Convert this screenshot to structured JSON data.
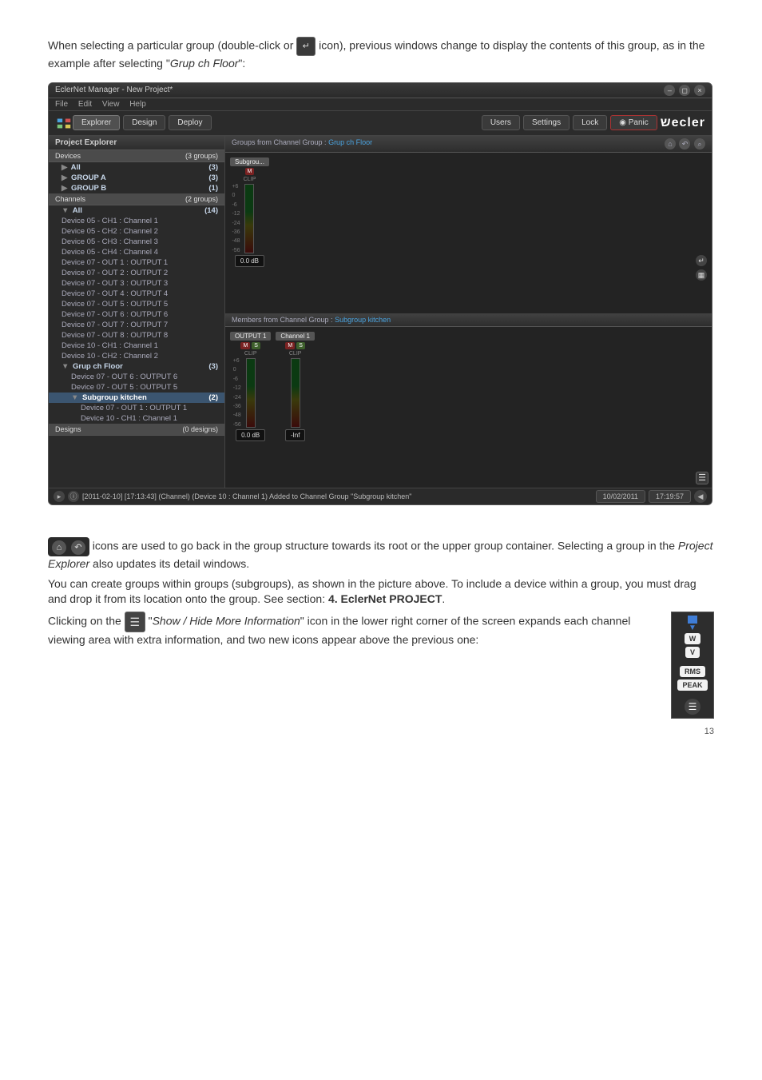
{
  "intro": {
    "p1a": "When selecting a particular group (double-click or ",
    "p1b": " icon), previous windows change to display the contents of this group, as in the example after selecting \"",
    "p1c": "Grup ch Floor",
    "p1d": "\":"
  },
  "app": {
    "title": "EclerNet Manager - New Project*",
    "menu": {
      "file": "File",
      "edit": "Edit",
      "view": "View",
      "help": "Help"
    },
    "toolbar": {
      "explorer": "Explorer",
      "design": "Design",
      "deploy": "Deploy",
      "users": "Users",
      "settings": "Settings",
      "lock": "Lock",
      "panic": "Panic",
      "logo": "ecler"
    },
    "explorer": {
      "panel_title": "Project Explorer",
      "devices_header": "Devices",
      "devices_count": "(3 groups)",
      "dev_all": "All",
      "dev_all_count": "(3)",
      "dev_a": "GROUP A",
      "dev_a_count": "(3)",
      "dev_b": "GROUP B",
      "dev_b_count": "(1)",
      "channels_header": "Channels",
      "channels_count": "(2 groups)",
      "ch_all": "All",
      "ch_all_count": "(14)",
      "items": [
        "Device 05 - CH1 : Channel 1",
        "Device 05 - CH2 : Channel 2",
        "Device 05 - CH3 : Channel 3",
        "Device 05 - CH4 : Channel 4",
        "Device 07 - OUT 1 : OUTPUT 1",
        "Device 07 - OUT 2 : OUTPUT 2",
        "Device 07 - OUT 3 : OUTPUT 3",
        "Device 07 - OUT 4 : OUTPUT 4",
        "Device 07 - OUT 5 : OUTPUT 5",
        "Device 07 - OUT 6 : OUTPUT 6",
        "Device 07 - OUT 7 : OUTPUT 7",
        "Device 07 - OUT 8 : OUTPUT 8",
        "Device 10 - CH1 : Channel 1",
        "Device 10 - CH2 : Channel 2"
      ],
      "grp_floor": "Grup ch Floor",
      "grp_floor_count": "(3)",
      "grp_floor_items": [
        "Device 07 - OUT 6 : OUTPUT 6",
        "Device 07 - OUT 5 : OUTPUT 5"
      ],
      "subgroup": "Subgroup kitchen",
      "subgroup_count": "(2)",
      "subgroup_items": [
        "Device 07 - OUT 1 : OUTPUT 1",
        "Device 10 - CH1 : Channel 1"
      ],
      "designs_header": "Designs",
      "designs_count": "(0 designs)"
    },
    "detail": {
      "groups_title_a": "Groups from Channel Group : ",
      "groups_title_b": "Grup ch Floor",
      "subgrou_label": "Subgrou...",
      "members_title_a": "Members from Channel Group : ",
      "members_title_b": "Subgroup kitchen",
      "out1_a": "OUTPUT 1",
      "out1_b": "Channel 1",
      "mute": "M",
      "solo": "S",
      "clip1": "CLIP",
      "clip2": "CLIP",
      "ticks": [
        "+6",
        "0",
        "-6",
        "-12",
        "-24",
        "-36",
        "-48",
        "-56"
      ],
      "ticks2": [
        "+6",
        "0",
        "-6",
        "-12",
        "-24",
        "-36",
        "-48",
        "-56"
      ],
      "db": "0.0 dB",
      "db2a": "0.0 dB",
      "db2b": "-Inf"
    },
    "status": {
      "log": "[2011-02-10] [17:13:43] (Channel) (Device 10 : Channel 1) Added to Channel Group \"Subgroup kitchen\"",
      "date": "10/02/2011",
      "time": "17:19:57"
    }
  },
  "body": {
    "p2": " icons are used to go back in the group structure towards its root or the upper group container. Selecting a group in the ",
    "p2_em": "Project Explorer",
    "p2b": " also updates its detail windows.",
    "p3": "You can create groups within groups (subgroups), as shown in the picture above. To include a device within a group, you must drag and drop it from its location onto the group. See section: ",
    "p3_bold": "4. EclerNet PROJECT",
    "p3b": ".",
    "p4a": "Clicking on the ",
    "p4b": " \"",
    "p4_em": "Show / Hide More Information",
    "p4c": "\" icon in the lower right corner of the screen expands each channel viewing area with extra information, and two new icons appear above the previous one:"
  },
  "side_widget": {
    "w": "W",
    "v": "V",
    "rms": "RMS",
    "peak": "PEAK"
  },
  "pagenum": "13"
}
